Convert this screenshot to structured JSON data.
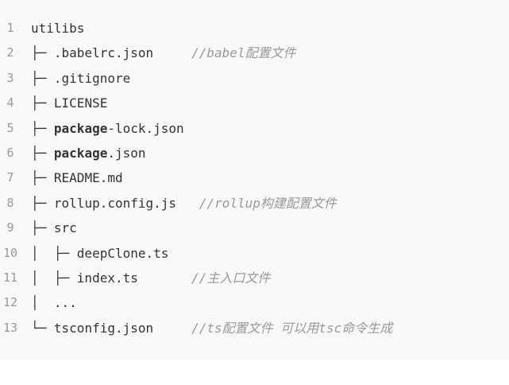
{
  "lines": [
    {
      "num": "1",
      "prefix": "",
      "bold": "",
      "text": "utilibs",
      "gap": 0,
      "comment": ""
    },
    {
      "num": "2",
      "prefix": "├─ ",
      "bold": "",
      "text": ".babelrc.json",
      "gap": 4,
      "comment": "//babel配置文件"
    },
    {
      "num": "3",
      "prefix": "├─ ",
      "bold": "",
      "text": ".gitignore",
      "gap": 0,
      "comment": ""
    },
    {
      "num": "4",
      "prefix": "├─ ",
      "bold": "",
      "text": "LICENSE",
      "gap": 0,
      "comment": ""
    },
    {
      "num": "5",
      "prefix": "├─ ",
      "bold": "package",
      "text": "-lock.json",
      "gap": 0,
      "comment": ""
    },
    {
      "num": "6",
      "prefix": "├─ ",
      "bold": "package",
      "text": ".json",
      "gap": 0,
      "comment": ""
    },
    {
      "num": "7",
      "prefix": "├─ ",
      "bold": "",
      "text": "README.md",
      "gap": 0,
      "comment": ""
    },
    {
      "num": "8",
      "prefix": "├─ ",
      "bold": "",
      "text": "rollup.config.js",
      "gap": 2,
      "comment": "//rollup构建配置文件"
    },
    {
      "num": "9",
      "prefix": "├─ ",
      "bold": "",
      "text": "src",
      "gap": 0,
      "comment": ""
    },
    {
      "num": "10",
      "prefix": "│  ├─ ",
      "bold": "",
      "text": "deepClone.ts",
      "gap": 0,
      "comment": ""
    },
    {
      "num": "11",
      "prefix": "│  ├─ ",
      "bold": "",
      "text": "index.ts",
      "gap": 6,
      "comment": "//主入口文件"
    },
    {
      "num": "12",
      "prefix": "│  ",
      "bold": "",
      "text": "...",
      "gap": 0,
      "comment": ""
    },
    {
      "num": "13",
      "prefix": "└─ ",
      "bold": "",
      "text": "tsconfig.json",
      "gap": 4,
      "comment": "//ts配置文件 可以用tsc命令生成"
    }
  ]
}
